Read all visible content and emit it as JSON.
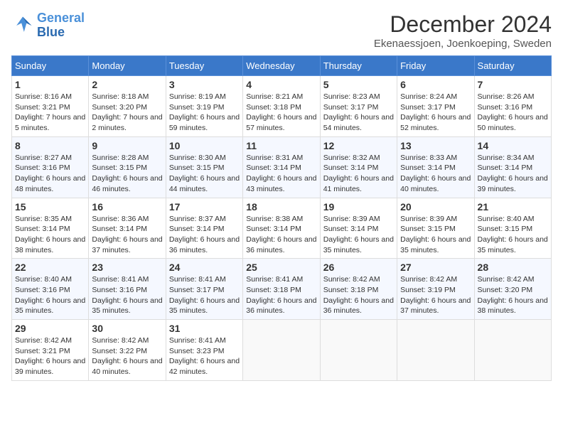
{
  "header": {
    "logo_line1": "General",
    "logo_line2": "Blue",
    "title": "December 2024",
    "subtitle": "Ekenaessjoen, Joenkoeping, Sweden"
  },
  "weekdays": [
    "Sunday",
    "Monday",
    "Tuesday",
    "Wednesday",
    "Thursday",
    "Friday",
    "Saturday"
  ],
  "weeks": [
    [
      {
        "day": "1",
        "sunrise": "8:16 AM",
        "sunset": "3:21 PM",
        "daylight": "7 hours and 5 minutes."
      },
      {
        "day": "2",
        "sunrise": "8:18 AM",
        "sunset": "3:20 PM",
        "daylight": "7 hours and 2 minutes."
      },
      {
        "day": "3",
        "sunrise": "8:19 AM",
        "sunset": "3:19 PM",
        "daylight": "6 hours and 59 minutes."
      },
      {
        "day": "4",
        "sunrise": "8:21 AM",
        "sunset": "3:18 PM",
        "daylight": "6 hours and 57 minutes."
      },
      {
        "day": "5",
        "sunrise": "8:23 AM",
        "sunset": "3:17 PM",
        "daylight": "6 hours and 54 minutes."
      },
      {
        "day": "6",
        "sunrise": "8:24 AM",
        "sunset": "3:17 PM",
        "daylight": "6 hours and 52 minutes."
      },
      {
        "day": "7",
        "sunrise": "8:26 AM",
        "sunset": "3:16 PM",
        "daylight": "6 hours and 50 minutes."
      }
    ],
    [
      {
        "day": "8",
        "sunrise": "8:27 AM",
        "sunset": "3:16 PM",
        "daylight": "6 hours and 48 minutes."
      },
      {
        "day": "9",
        "sunrise": "8:28 AM",
        "sunset": "3:15 PM",
        "daylight": "6 hours and 46 minutes."
      },
      {
        "day": "10",
        "sunrise": "8:30 AM",
        "sunset": "3:15 PM",
        "daylight": "6 hours and 44 minutes."
      },
      {
        "day": "11",
        "sunrise": "8:31 AM",
        "sunset": "3:14 PM",
        "daylight": "6 hours and 43 minutes."
      },
      {
        "day": "12",
        "sunrise": "8:32 AM",
        "sunset": "3:14 PM",
        "daylight": "6 hours and 41 minutes."
      },
      {
        "day": "13",
        "sunrise": "8:33 AM",
        "sunset": "3:14 PM",
        "daylight": "6 hours and 40 minutes."
      },
      {
        "day": "14",
        "sunrise": "8:34 AM",
        "sunset": "3:14 PM",
        "daylight": "6 hours and 39 minutes."
      }
    ],
    [
      {
        "day": "15",
        "sunrise": "8:35 AM",
        "sunset": "3:14 PM",
        "daylight": "6 hours and 38 minutes."
      },
      {
        "day": "16",
        "sunrise": "8:36 AM",
        "sunset": "3:14 PM",
        "daylight": "6 hours and 37 minutes."
      },
      {
        "day": "17",
        "sunrise": "8:37 AM",
        "sunset": "3:14 PM",
        "daylight": "6 hours and 36 minutes."
      },
      {
        "day": "18",
        "sunrise": "8:38 AM",
        "sunset": "3:14 PM",
        "daylight": "6 hours and 36 minutes."
      },
      {
        "day": "19",
        "sunrise": "8:39 AM",
        "sunset": "3:14 PM",
        "daylight": "6 hours and 35 minutes."
      },
      {
        "day": "20",
        "sunrise": "8:39 AM",
        "sunset": "3:15 PM",
        "daylight": "6 hours and 35 minutes."
      },
      {
        "day": "21",
        "sunrise": "8:40 AM",
        "sunset": "3:15 PM",
        "daylight": "6 hours and 35 minutes."
      }
    ],
    [
      {
        "day": "22",
        "sunrise": "8:40 AM",
        "sunset": "3:16 PM",
        "daylight": "6 hours and 35 minutes."
      },
      {
        "day": "23",
        "sunrise": "8:41 AM",
        "sunset": "3:16 PM",
        "daylight": "6 hours and 35 minutes."
      },
      {
        "day": "24",
        "sunrise": "8:41 AM",
        "sunset": "3:17 PM",
        "daylight": "6 hours and 35 minutes."
      },
      {
        "day": "25",
        "sunrise": "8:41 AM",
        "sunset": "3:18 PM",
        "daylight": "6 hours and 36 minutes."
      },
      {
        "day": "26",
        "sunrise": "8:42 AM",
        "sunset": "3:18 PM",
        "daylight": "6 hours and 36 minutes."
      },
      {
        "day": "27",
        "sunrise": "8:42 AM",
        "sunset": "3:19 PM",
        "daylight": "6 hours and 37 minutes."
      },
      {
        "day": "28",
        "sunrise": "8:42 AM",
        "sunset": "3:20 PM",
        "daylight": "6 hours and 38 minutes."
      }
    ],
    [
      {
        "day": "29",
        "sunrise": "8:42 AM",
        "sunset": "3:21 PM",
        "daylight": "6 hours and 39 minutes."
      },
      {
        "day": "30",
        "sunrise": "8:42 AM",
        "sunset": "3:22 PM",
        "daylight": "6 hours and 40 minutes."
      },
      {
        "day": "31",
        "sunrise": "8:41 AM",
        "sunset": "3:23 PM",
        "daylight": "6 hours and 42 minutes."
      },
      null,
      null,
      null,
      null
    ]
  ]
}
